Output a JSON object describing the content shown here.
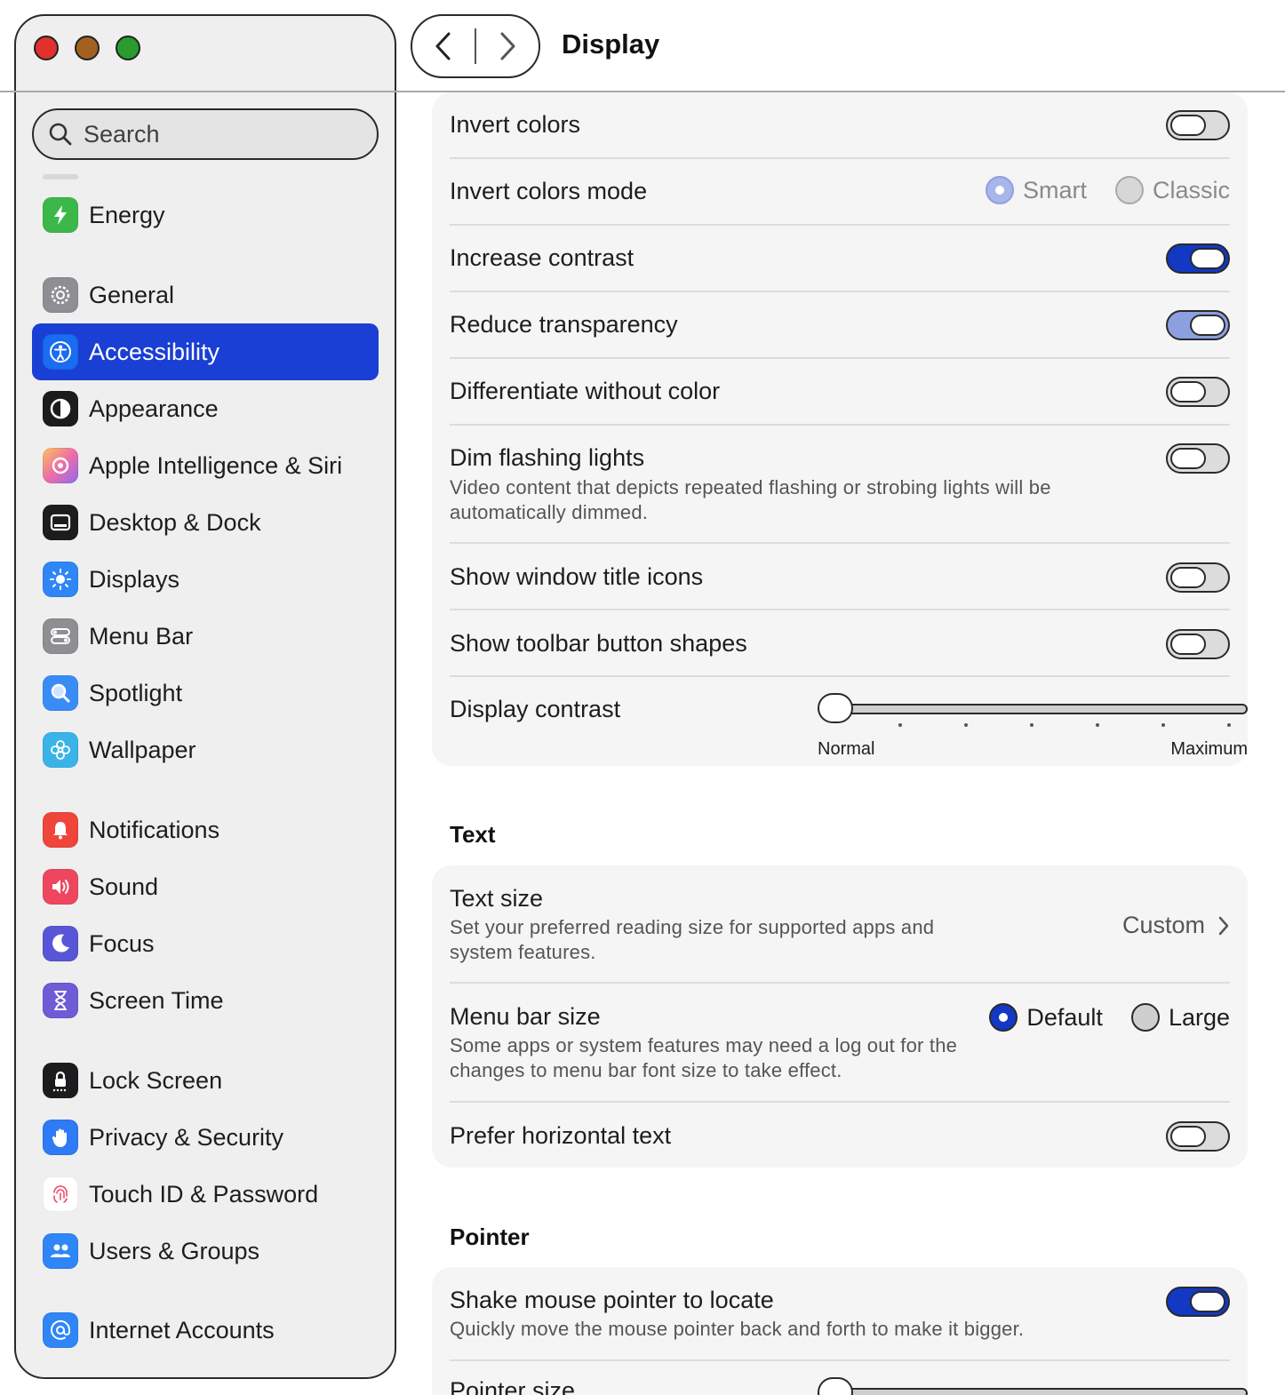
{
  "window": {
    "title": "Display"
  },
  "sidebar": {
    "search_placeholder": "Search",
    "items": [
      {
        "label": "Energy",
        "icon": "energy-icon",
        "color": "#3cb84a"
      },
      {
        "label": "General",
        "icon": "gear-icon",
        "color": "#8e8e93"
      },
      {
        "label": "Accessibility",
        "icon": "accessibility-icon",
        "color": "#1a6cf0",
        "selected": true
      },
      {
        "label": "Appearance",
        "icon": "appearance-icon",
        "color": "#1c1c1e"
      },
      {
        "label": "Apple Intelligence & Siri",
        "icon": "siri-icon",
        "color": "#f39bd0"
      },
      {
        "label": "Desktop & Dock",
        "icon": "dock-icon",
        "color": "#1c1c1e"
      },
      {
        "label": "Displays",
        "icon": "sun-icon",
        "color": "#2f86f6"
      },
      {
        "label": "Menu Bar",
        "icon": "menu-bar-icon",
        "color": "#8e8e93"
      },
      {
        "label": "Spotlight",
        "icon": "spotlight-icon",
        "color": "#3a8cf5"
      },
      {
        "label": "Wallpaper",
        "icon": "flower-icon",
        "color": "#3ab4e8"
      },
      {
        "label": "Notifications",
        "icon": "bell-icon",
        "color": "#f0453b"
      },
      {
        "label": "Sound",
        "icon": "speaker-icon",
        "color": "#ef4660"
      },
      {
        "label": "Focus",
        "icon": "moon-icon",
        "color": "#5856d6"
      },
      {
        "label": "Screen Time",
        "icon": "hourglass-icon",
        "color": "#6e5bd6"
      },
      {
        "label": "Lock Screen",
        "icon": "lock-icon",
        "color": "#1c1c1e"
      },
      {
        "label": "Privacy & Security",
        "icon": "hand-icon",
        "color": "#2f7af5"
      },
      {
        "label": "Touch ID & Password",
        "icon": "fingerprint-icon",
        "color": "#ffffff"
      },
      {
        "label": "Users & Groups",
        "icon": "users-icon",
        "color": "#2f86f6"
      },
      {
        "label": "Internet Accounts",
        "icon": "at-icon",
        "color": "#2f86f6"
      }
    ]
  },
  "display_section": {
    "rows": [
      {
        "title": "Invert colors",
        "control": "toggle",
        "on": false
      },
      {
        "title": "Invert colors mode",
        "control": "radio",
        "options": [
          "Smart",
          "Classic"
        ],
        "selected": "Smart",
        "disabled": true
      },
      {
        "title": "Increase contrast",
        "control": "toggle",
        "on": true
      },
      {
        "title": "Reduce transparency",
        "control": "toggle",
        "on": true,
        "dimmed": true
      },
      {
        "title": "Differentiate without color",
        "control": "toggle",
        "on": false
      },
      {
        "title": "Dim flashing lights",
        "description": "Video content that depicts repeated flashing or strobing lights will be automatically dimmed.",
        "control": "toggle",
        "on": false
      },
      {
        "title": "Show window title icons",
        "control": "toggle",
        "on": false
      },
      {
        "title": "Show toolbar button shapes",
        "control": "toggle",
        "on": false
      },
      {
        "title": "Display contrast",
        "control": "slider",
        "min_label": "Normal",
        "max_label": "Maximum",
        "value": 0
      }
    ]
  },
  "text_section": {
    "title": "Text",
    "text_size": {
      "title": "Text size",
      "description": "Set your preferred reading size for supported apps and system features.",
      "value": "Custom"
    },
    "menu_bar_size": {
      "title": "Menu bar size",
      "description": "Some apps or system features may need a log out for the changes to menu bar font size to take effect.",
      "options": [
        "Default",
        "Large"
      ],
      "selected": "Default"
    },
    "prefer_horizontal": {
      "title": "Prefer horizontal text",
      "on": false
    }
  },
  "pointer_section": {
    "title": "Pointer",
    "shake": {
      "title": "Shake mouse pointer to locate",
      "description": "Quickly move the mouse pointer back and forth to make it bigger.",
      "on": true
    },
    "pointer_size": {
      "title": "Pointer size"
    }
  }
}
